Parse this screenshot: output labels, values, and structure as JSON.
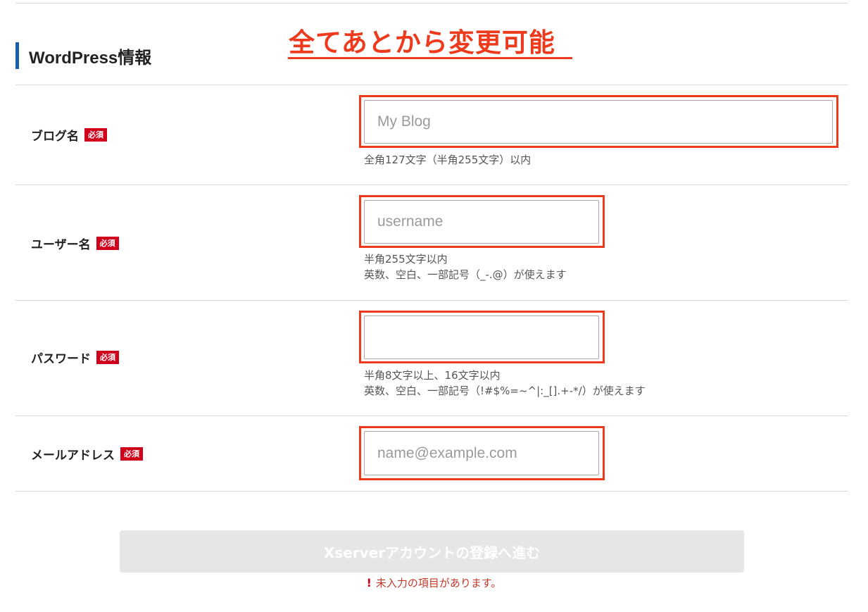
{
  "section": {
    "title": "WordPress情報",
    "annotation": "全てあとから変更可能"
  },
  "fields": {
    "blog_name": {
      "label": "ブログ名",
      "badge": "必須",
      "placeholder": "My Blog",
      "value": "",
      "help": [
        "全角127文字（半角255文字）以内"
      ]
    },
    "username": {
      "label": "ユーザー名",
      "badge": "必須",
      "placeholder": "username",
      "value": "",
      "help": [
        "半角255文字以内",
        "英数、空白、一部記号（_-.@）が使えます"
      ]
    },
    "password": {
      "label": "パスワード",
      "badge": "必須",
      "placeholder": "",
      "value": "",
      "help": [
        "半角8文字以上、16文字以内",
        "英数、空白、一部記号（!#$%=~^|:_[].+-*/）が使えます"
      ]
    },
    "email": {
      "label": "メールアドレス",
      "badge": "必須",
      "placeholder": "name@example.com",
      "value": "",
      "help": []
    }
  },
  "submit": {
    "label": "Xserverアカウントの登録へ進む"
  },
  "error": {
    "icon": "!",
    "message": "未入力の項目があります。"
  },
  "colors": {
    "accent_bar": "#1a5fa8",
    "annotation": "#ee3a1c",
    "required_badge": "#d0021b",
    "button_disabled": "#e6e6e6",
    "error_text": "#c0392b"
  },
  "icons": {
    "error": "exclamation-icon"
  }
}
